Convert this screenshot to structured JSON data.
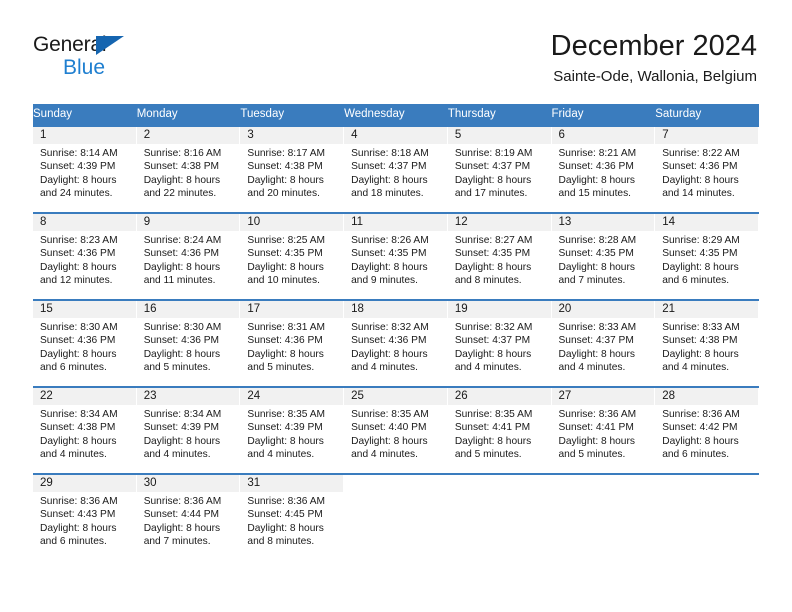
{
  "logo": {
    "word_one": "General",
    "word_two": "Blue",
    "triangle_icon": "triangle-icon",
    "brand_color": "#1f7fd0",
    "triangle_color": "#1565b0"
  },
  "header": {
    "title": "December 2024",
    "subtitle": "Sainte-Ode, Wallonia, Belgium"
  },
  "calendar": {
    "header_bg": "#3a7cbe",
    "header_text_color": "#ffffff",
    "daynum_bg": "#f1f1f1",
    "weekday_headers": [
      "Sunday",
      "Monday",
      "Tuesday",
      "Wednesday",
      "Thursday",
      "Friday",
      "Saturday"
    ],
    "weeks": [
      [
        {
          "day": "1",
          "sunrise": "Sunrise: 8:14 AM",
          "sunset": "Sunset: 4:39 PM",
          "daylight_line1": "Daylight: 8 hours",
          "daylight_line2": "and 24 minutes."
        },
        {
          "day": "2",
          "sunrise": "Sunrise: 8:16 AM",
          "sunset": "Sunset: 4:38 PM",
          "daylight_line1": "Daylight: 8 hours",
          "daylight_line2": "and 22 minutes."
        },
        {
          "day": "3",
          "sunrise": "Sunrise: 8:17 AM",
          "sunset": "Sunset: 4:38 PM",
          "daylight_line1": "Daylight: 8 hours",
          "daylight_line2": "and 20 minutes."
        },
        {
          "day": "4",
          "sunrise": "Sunrise: 8:18 AM",
          "sunset": "Sunset: 4:37 PM",
          "daylight_line1": "Daylight: 8 hours",
          "daylight_line2": "and 18 minutes."
        },
        {
          "day": "5",
          "sunrise": "Sunrise: 8:19 AM",
          "sunset": "Sunset: 4:37 PM",
          "daylight_line1": "Daylight: 8 hours",
          "daylight_line2": "and 17 minutes."
        },
        {
          "day": "6",
          "sunrise": "Sunrise: 8:21 AM",
          "sunset": "Sunset: 4:36 PM",
          "daylight_line1": "Daylight: 8 hours",
          "daylight_line2": "and 15 minutes."
        },
        {
          "day": "7",
          "sunrise": "Sunrise: 8:22 AM",
          "sunset": "Sunset: 4:36 PM",
          "daylight_line1": "Daylight: 8 hours",
          "daylight_line2": "and 14 minutes."
        }
      ],
      [
        {
          "day": "8",
          "sunrise": "Sunrise: 8:23 AM",
          "sunset": "Sunset: 4:36 PM",
          "daylight_line1": "Daylight: 8 hours",
          "daylight_line2": "and 12 minutes."
        },
        {
          "day": "9",
          "sunrise": "Sunrise: 8:24 AM",
          "sunset": "Sunset: 4:36 PM",
          "daylight_line1": "Daylight: 8 hours",
          "daylight_line2": "and 11 minutes."
        },
        {
          "day": "10",
          "sunrise": "Sunrise: 8:25 AM",
          "sunset": "Sunset: 4:35 PM",
          "daylight_line1": "Daylight: 8 hours",
          "daylight_line2": "and 10 minutes."
        },
        {
          "day": "11",
          "sunrise": "Sunrise: 8:26 AM",
          "sunset": "Sunset: 4:35 PM",
          "daylight_line1": "Daylight: 8 hours",
          "daylight_line2": "and 9 minutes."
        },
        {
          "day": "12",
          "sunrise": "Sunrise: 8:27 AM",
          "sunset": "Sunset: 4:35 PM",
          "daylight_line1": "Daylight: 8 hours",
          "daylight_line2": "and 8 minutes."
        },
        {
          "day": "13",
          "sunrise": "Sunrise: 8:28 AM",
          "sunset": "Sunset: 4:35 PM",
          "daylight_line1": "Daylight: 8 hours",
          "daylight_line2": "and 7 minutes."
        },
        {
          "day": "14",
          "sunrise": "Sunrise: 8:29 AM",
          "sunset": "Sunset: 4:35 PM",
          "daylight_line1": "Daylight: 8 hours",
          "daylight_line2": "and 6 minutes."
        }
      ],
      [
        {
          "day": "15",
          "sunrise": "Sunrise: 8:30 AM",
          "sunset": "Sunset: 4:36 PM",
          "daylight_line1": "Daylight: 8 hours",
          "daylight_line2": "and 6 minutes."
        },
        {
          "day": "16",
          "sunrise": "Sunrise: 8:30 AM",
          "sunset": "Sunset: 4:36 PM",
          "daylight_line1": "Daylight: 8 hours",
          "daylight_line2": "and 5 minutes."
        },
        {
          "day": "17",
          "sunrise": "Sunrise: 8:31 AM",
          "sunset": "Sunset: 4:36 PM",
          "daylight_line1": "Daylight: 8 hours",
          "daylight_line2": "and 5 minutes."
        },
        {
          "day": "18",
          "sunrise": "Sunrise: 8:32 AM",
          "sunset": "Sunset: 4:36 PM",
          "daylight_line1": "Daylight: 8 hours",
          "daylight_line2": "and 4 minutes."
        },
        {
          "day": "19",
          "sunrise": "Sunrise: 8:32 AM",
          "sunset": "Sunset: 4:37 PM",
          "daylight_line1": "Daylight: 8 hours",
          "daylight_line2": "and 4 minutes."
        },
        {
          "day": "20",
          "sunrise": "Sunrise: 8:33 AM",
          "sunset": "Sunset: 4:37 PM",
          "daylight_line1": "Daylight: 8 hours",
          "daylight_line2": "and 4 minutes."
        },
        {
          "day": "21",
          "sunrise": "Sunrise: 8:33 AM",
          "sunset": "Sunset: 4:38 PM",
          "daylight_line1": "Daylight: 8 hours",
          "daylight_line2": "and 4 minutes."
        }
      ],
      [
        {
          "day": "22",
          "sunrise": "Sunrise: 8:34 AM",
          "sunset": "Sunset: 4:38 PM",
          "daylight_line1": "Daylight: 8 hours",
          "daylight_line2": "and 4 minutes."
        },
        {
          "day": "23",
          "sunrise": "Sunrise: 8:34 AM",
          "sunset": "Sunset: 4:39 PM",
          "daylight_line1": "Daylight: 8 hours",
          "daylight_line2": "and 4 minutes."
        },
        {
          "day": "24",
          "sunrise": "Sunrise: 8:35 AM",
          "sunset": "Sunset: 4:39 PM",
          "daylight_line1": "Daylight: 8 hours",
          "daylight_line2": "and 4 minutes."
        },
        {
          "day": "25",
          "sunrise": "Sunrise: 8:35 AM",
          "sunset": "Sunset: 4:40 PM",
          "daylight_line1": "Daylight: 8 hours",
          "daylight_line2": "and 4 minutes."
        },
        {
          "day": "26",
          "sunrise": "Sunrise: 8:35 AM",
          "sunset": "Sunset: 4:41 PM",
          "daylight_line1": "Daylight: 8 hours",
          "daylight_line2": "and 5 minutes."
        },
        {
          "day": "27",
          "sunrise": "Sunrise: 8:36 AM",
          "sunset": "Sunset: 4:41 PM",
          "daylight_line1": "Daylight: 8 hours",
          "daylight_line2": "and 5 minutes."
        },
        {
          "day": "28",
          "sunrise": "Sunrise: 8:36 AM",
          "sunset": "Sunset: 4:42 PM",
          "daylight_line1": "Daylight: 8 hours",
          "daylight_line2": "and 6 minutes."
        }
      ],
      [
        {
          "day": "29",
          "sunrise": "Sunrise: 8:36 AM",
          "sunset": "Sunset: 4:43 PM",
          "daylight_line1": "Daylight: 8 hours",
          "daylight_line2": "and 6 minutes."
        },
        {
          "day": "30",
          "sunrise": "Sunrise: 8:36 AM",
          "sunset": "Sunset: 4:44 PM",
          "daylight_line1": "Daylight: 8 hours",
          "daylight_line2": "and 7 minutes."
        },
        {
          "day": "31",
          "sunrise": "Sunrise: 8:36 AM",
          "sunset": "Sunset: 4:45 PM",
          "daylight_line1": "Daylight: 8 hours",
          "daylight_line2": "and 8 minutes."
        },
        {
          "day": "",
          "sunrise": "",
          "sunset": "",
          "daylight_line1": "",
          "daylight_line2": ""
        },
        {
          "day": "",
          "sunrise": "",
          "sunset": "",
          "daylight_line1": "",
          "daylight_line2": ""
        },
        {
          "day": "",
          "sunrise": "",
          "sunset": "",
          "daylight_line1": "",
          "daylight_line2": ""
        },
        {
          "day": "",
          "sunrise": "",
          "sunset": "",
          "daylight_line1": "",
          "daylight_line2": ""
        }
      ]
    ]
  }
}
